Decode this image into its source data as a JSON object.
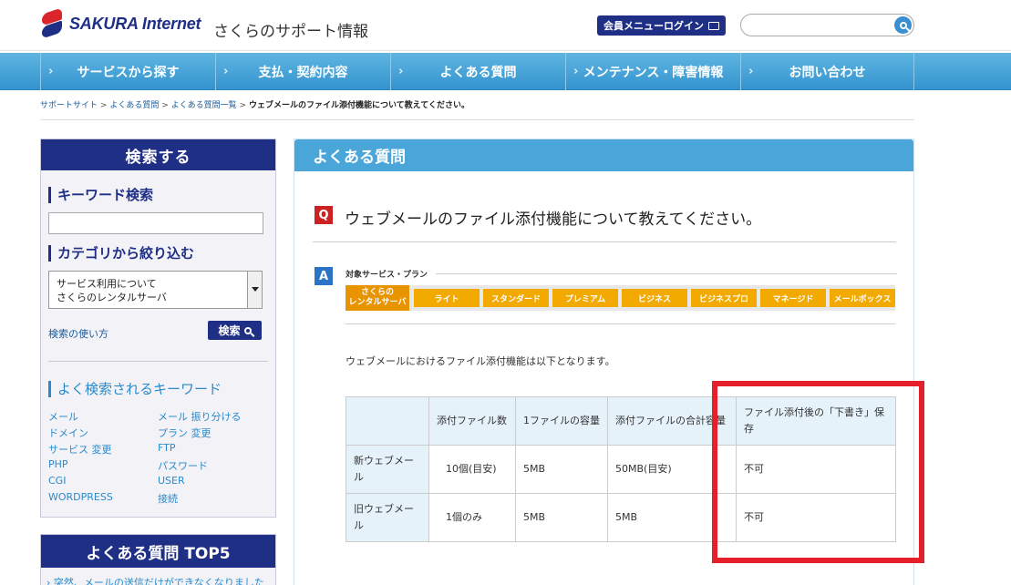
{
  "header": {
    "logo_text": "SAKURA Internet",
    "site_title": "さくらのサポート情報",
    "member_login": "会員メニューログイン",
    "search_placeholder": ""
  },
  "nav": {
    "items": [
      "サービスから探す",
      "支払・契約内容",
      "よくある質問",
      "メンテナンス・障害情報",
      "お問い合わせ"
    ]
  },
  "breadcrumb": {
    "items": [
      "サポートサイト",
      "よくある質問",
      "よくある質問一覧"
    ],
    "separator": ">",
    "current": "ウェブメールのファイル添付機能について教えてください。"
  },
  "sidebar": {
    "head": "検索する",
    "keyword_title": "キーワード検索",
    "keyword_value": "",
    "category_title": "カテゴリから絞り込む",
    "category_line1": "サービス利用について",
    "category_line2": "さくらのレンタルサーバ",
    "howto": "検索の使い方",
    "search_btn": "検索",
    "popular_title": "よく検索されるキーワード",
    "keywords_left": [
      "メール",
      "ドメイン",
      "サービス 変更",
      "PHP",
      "CGI",
      "WORDPRESS"
    ],
    "keywords_right": [
      "メール 振り分ける",
      "プラン 変更",
      "FTP",
      "パスワード",
      "USER",
      "接続"
    ]
  },
  "top5": {
    "head": "よくある質問 TOP5",
    "first_item": "突然、メールの送信だけができなくなりました"
  },
  "main": {
    "head": "よくある質問",
    "q_badge": "Q",
    "question": "ウェブメールのファイル添付機能について教えてください。",
    "a_badge": "A",
    "plan_label": "対象サービス・プラン",
    "plan_active_line1": "さくらの",
    "plan_active_line2": "レンタルサーバ",
    "plans": [
      "ライト",
      "スタンダード",
      "プレミアム",
      "ビジネス",
      "ビジネスプロ",
      "マネージド",
      "メールボックス"
    ],
    "description": "ウェブメールにおけるファイル添付機能は以下となります。"
  },
  "table": {
    "headers": [
      "",
      "添付ファイル数",
      "1ファイルの容量",
      "添付ファイルの合計容量",
      "ファイル添付後の「下書き」保存"
    ],
    "rows": [
      [
        "新ウェブメール",
        "10個(目安)",
        "5MB",
        "50MB(目安)",
        "不可"
      ],
      [
        "旧ウェブメール",
        "1個のみ",
        "5MB",
        "5MB",
        "不可"
      ]
    ]
  },
  "colors": {
    "brand_navy": "#1f2f86",
    "brand_red": "#d9252b",
    "nav_blue": "#3494cf",
    "plan_orange": "#f2a900",
    "highlight_red": "#e5202b"
  }
}
